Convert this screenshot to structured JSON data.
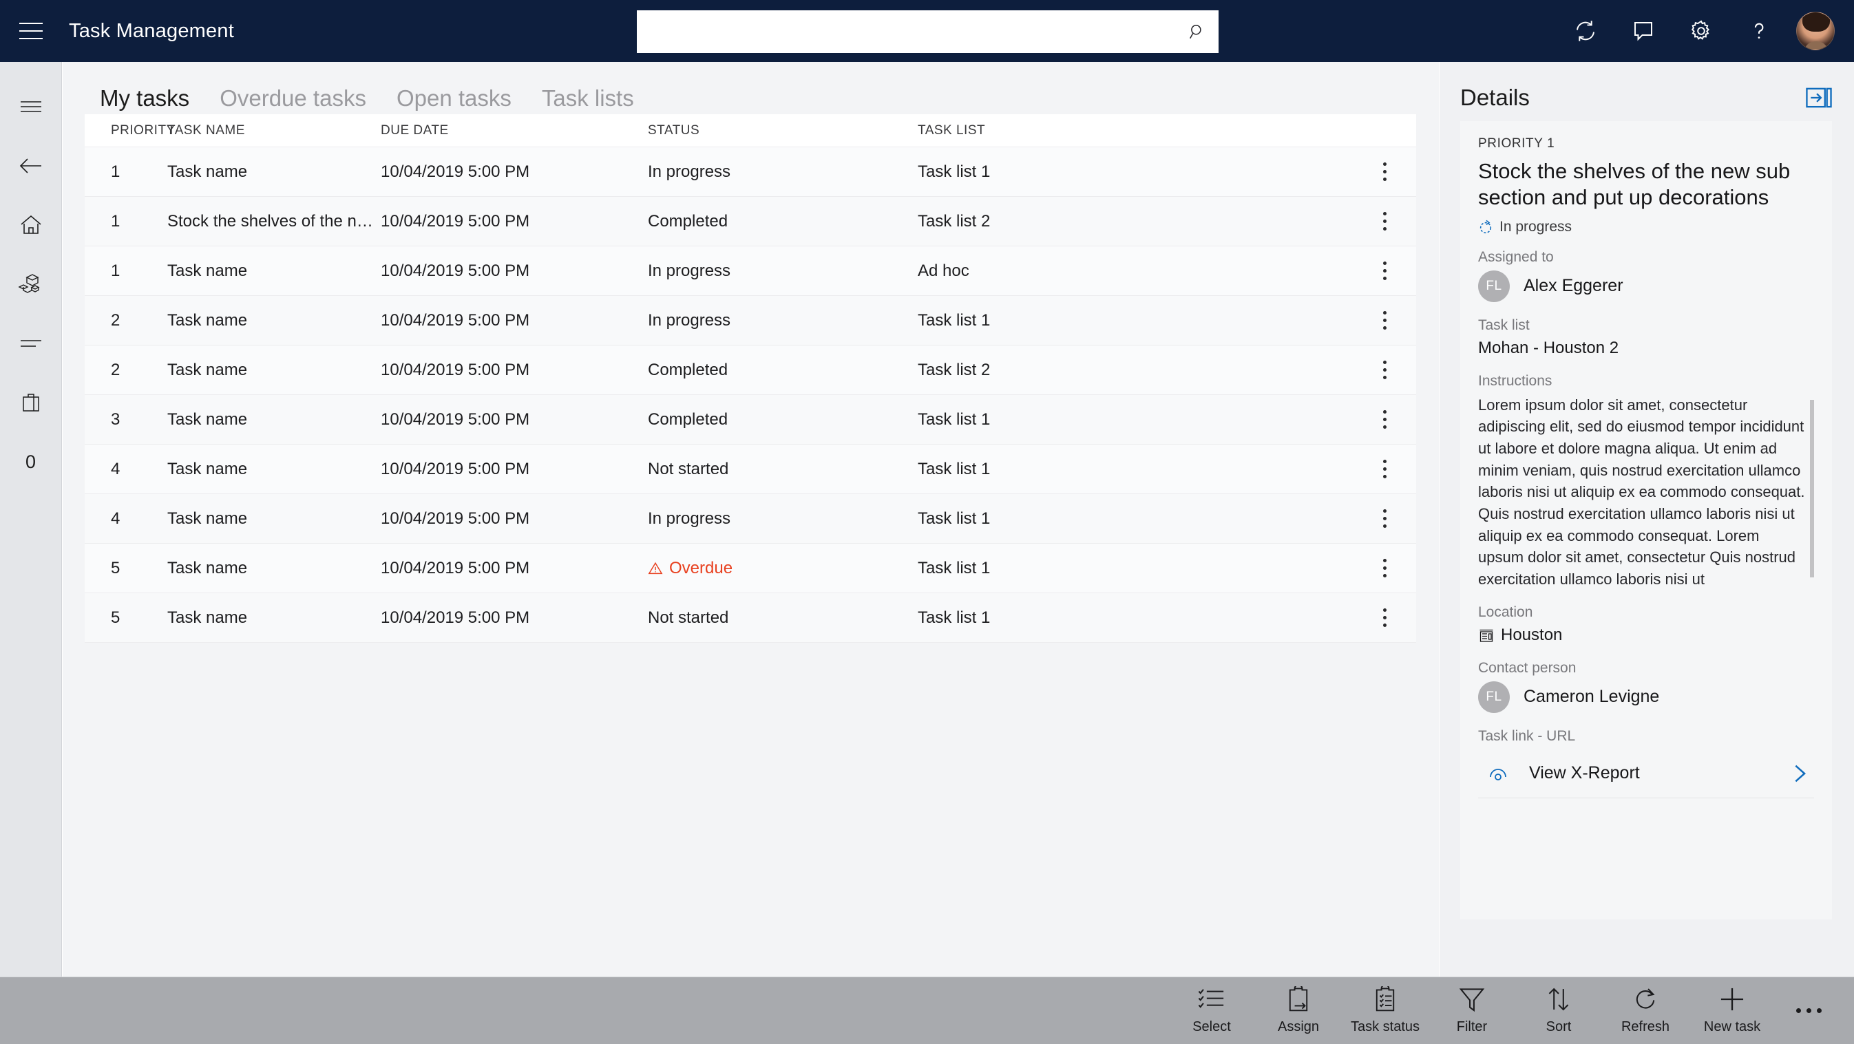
{
  "app": {
    "title": "Task Management",
    "menu_icon": "hamburger-icon"
  },
  "search": {
    "value": "",
    "placeholder": "",
    "icon": "search-icon"
  },
  "header_actions": [
    {
      "name": "refresh-icon",
      "label": "Refresh"
    },
    {
      "name": "feedback-icon",
      "label": "Feedback"
    },
    {
      "name": "gear-icon",
      "label": "Settings"
    },
    {
      "name": "help-icon",
      "label": "Help"
    },
    {
      "name": "user-avatar",
      "label": "Account"
    }
  ],
  "rail": {
    "items": [
      {
        "name": "list-menu-icon",
        "label": "Menu"
      },
      {
        "name": "back-arrow-icon",
        "label": "Back"
      },
      {
        "name": "home-icon",
        "label": "Home"
      },
      {
        "name": "products-icon",
        "label": "Products"
      },
      {
        "name": "lines-icon",
        "label": "Lines"
      },
      {
        "name": "bag-icon",
        "label": "Bag"
      }
    ],
    "count": "0"
  },
  "tabs": [
    {
      "label": "My tasks",
      "active": true
    },
    {
      "label": "Overdue tasks",
      "active": false
    },
    {
      "label": "Open tasks",
      "active": false
    },
    {
      "label": "Task lists",
      "active": false
    }
  ],
  "table": {
    "columns": [
      "PRIORITY",
      "TASK NAME",
      "DUE DATE",
      "STATUS",
      "TASK LIST"
    ],
    "rows": [
      {
        "priority": "1",
        "name": "Task name",
        "due": "10/04/2019 5:00 PM",
        "status": "In progress",
        "overdue": false,
        "list": "Task list 1"
      },
      {
        "priority": "1",
        "name": "Stock the shelves of the new sub section...",
        "due": "10/04/2019 5:00 PM",
        "status": "Completed",
        "overdue": false,
        "list": "Task list 2"
      },
      {
        "priority": "1",
        "name": "Task name",
        "due": "10/04/2019 5:00 PM",
        "status": "In progress",
        "overdue": false,
        "list": "Ad hoc"
      },
      {
        "priority": "2",
        "name": "Task name",
        "due": "10/04/2019 5:00 PM",
        "status": "In progress",
        "overdue": false,
        "list": "Task list 1"
      },
      {
        "priority": "2",
        "name": "Task name",
        "due": "10/04/2019 5:00 PM",
        "status": "Completed",
        "overdue": false,
        "list": "Task list 2"
      },
      {
        "priority": "3",
        "name": "Task name",
        "due": "10/04/2019 5:00 PM",
        "status": "Completed",
        "overdue": false,
        "list": "Task list 1"
      },
      {
        "priority": "4",
        "name": "Task name",
        "due": "10/04/2019 5:00 PM",
        "status": "Not started",
        "overdue": false,
        "list": "Task list 1"
      },
      {
        "priority": "4",
        "name": "Task name",
        "due": "10/04/2019 5:00 PM",
        "status": "In progress",
        "overdue": false,
        "list": "Task list 1"
      },
      {
        "priority": "5",
        "name": "Task name",
        "due": "10/04/2019 5:00 PM",
        "status": "Overdue",
        "overdue": true,
        "list": "Task list 1"
      },
      {
        "priority": "5",
        "name": "Task name",
        "due": "10/04/2019 5:00 PM",
        "status": "Not started",
        "overdue": false,
        "list": "Task list 1"
      }
    ]
  },
  "details": {
    "title": "Details",
    "expand_icon": "expand-panel-icon",
    "priority": "PRIORITY 1",
    "task_name": "Stock the shelves of the new sub section and put up decorations",
    "status": "In progress",
    "status_icon": "in-progress-icon",
    "assigned_to_label": "Assigned to",
    "assigned_to_name": "Alex Eggerer",
    "assigned_to_initials": "FL",
    "task_list_label": "Task list",
    "task_list_value": "Mohan - Houston 2",
    "instructions_label": "Instructions",
    "instructions_text": "Lorem ipsum dolor sit amet, consectetur adipiscing elit, sed do eiusmod tempor incididunt ut labore et dolore magna aliqua. Ut enim ad minim veniam, quis nostrud exercitation ullamco laboris nisi ut aliquip ex ea commodo consequat. Quis nostrud exercitation ullamco laboris nisi ut aliquip ex ea commodo consequat. Lorem upsum dolor sit amet, consectetur Quis nostrud exercitation ullamco laboris nisi ut",
    "location_label": "Location",
    "location_value": "Houston",
    "location_icon": "store-icon",
    "contact_label": "Contact person",
    "contact_name": "Cameron Levigne",
    "contact_initials": "FL",
    "task_link_label": "Task link - URL",
    "task_link_text": "View X-Report",
    "task_link_icon": "report-icon",
    "task_link_chevron": "chevron-right-icon"
  },
  "command_bar": {
    "items": [
      {
        "label": "Select",
        "icon": "select-list-icon"
      },
      {
        "label": "Assign",
        "icon": "assign-clipboard-icon"
      },
      {
        "label": "Task status",
        "icon": "task-status-clipboard-icon"
      },
      {
        "label": "Filter",
        "icon": "filter-funnel-icon"
      },
      {
        "label": "Sort",
        "icon": "sort-arrows-icon"
      },
      {
        "label": "Refresh",
        "icon": "refresh-circle-icon"
      },
      {
        "label": "New task",
        "icon": "plus-icon"
      }
    ],
    "more_icon": "ellipsis-icon"
  },
  "colors": {
    "header_bg": "#0d1e3d",
    "accent_blue": "#0f6cbd",
    "overdue_red": "#e8401f",
    "cmdbar_bg": "#a8aaae"
  }
}
